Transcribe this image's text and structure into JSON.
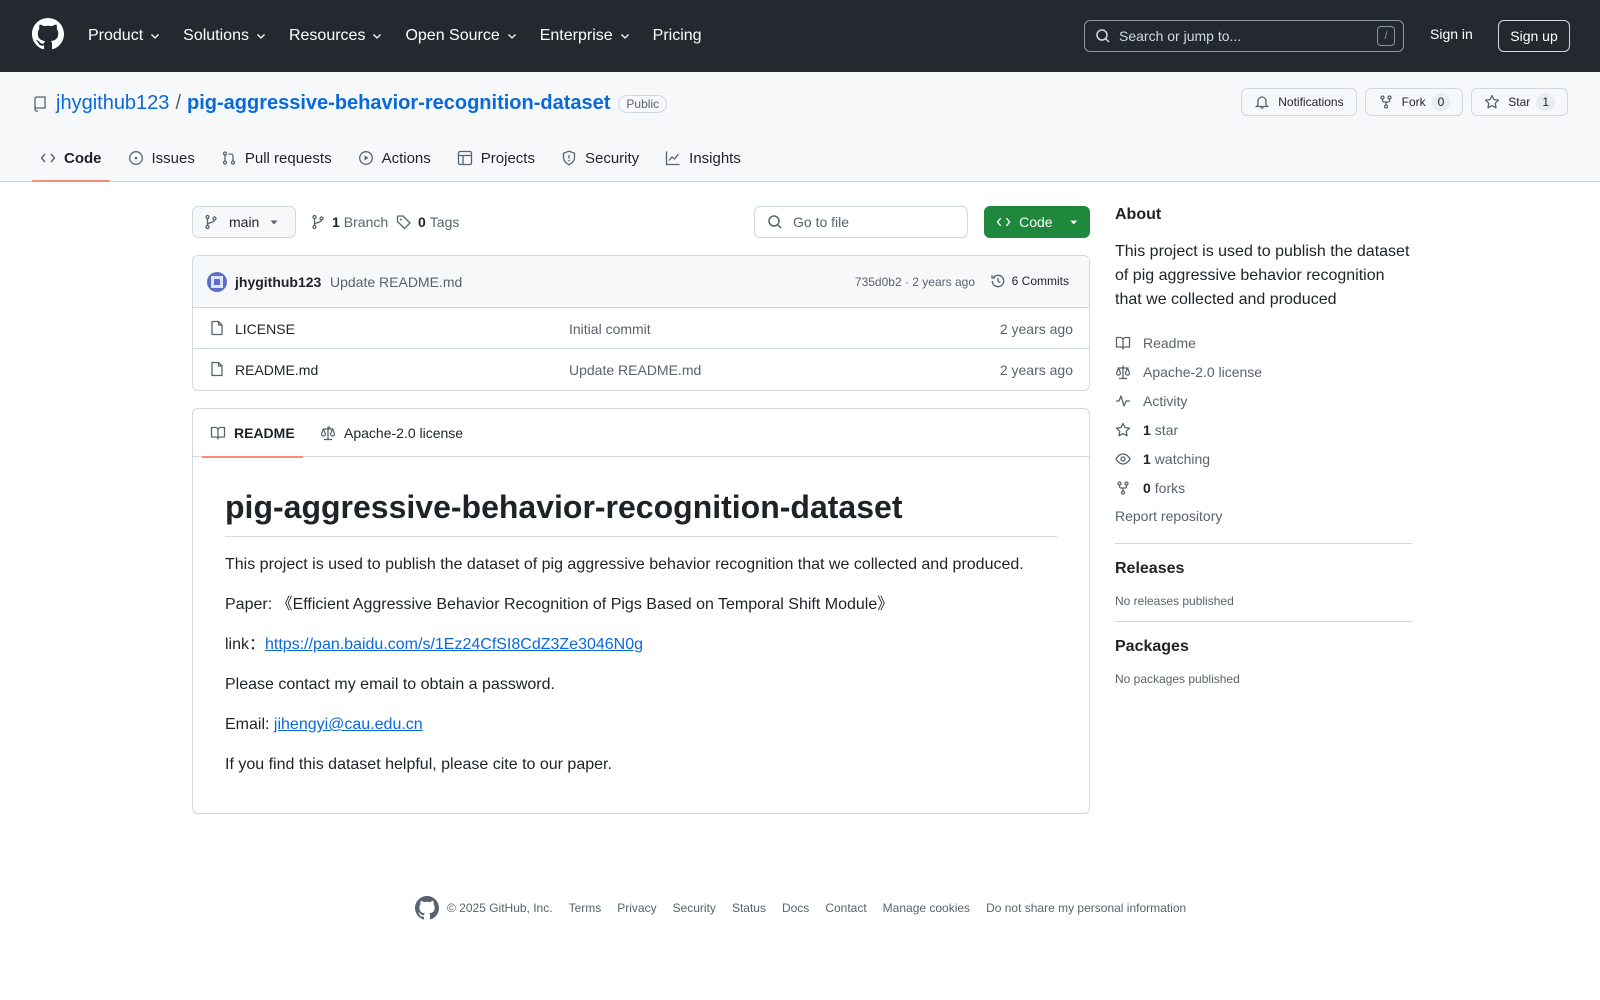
{
  "header": {
    "nav": [
      "Product",
      "Solutions",
      "Resources",
      "Open Source",
      "Enterprise",
      "Pricing"
    ],
    "search_placeholder": "Search or jump to...",
    "search_shortcut": "/",
    "sign_in": "Sign in",
    "sign_up": "Sign up"
  },
  "repo": {
    "owner": "jhygithub123",
    "separator": "/",
    "name": "pig-aggressive-behavior-recognition-dataset",
    "visibility": "Public",
    "actions": {
      "notifications": "Notifications",
      "fork": "Fork",
      "fork_count": "0",
      "star": "Star",
      "star_count": "1"
    },
    "tabs": [
      "Code",
      "Issues",
      "Pull requests",
      "Actions",
      "Projects",
      "Security",
      "Insights"
    ]
  },
  "toolbar": {
    "branch": "main",
    "branch_count": "1",
    "branch_label": "Branch",
    "tag_count": "0",
    "tag_label": "Tags",
    "goto_placeholder": "Go to file",
    "code_button": "Code"
  },
  "commit": {
    "author": "jhygithub123",
    "message": "Update README.md",
    "meta": "735d0b2 · 2 years ago",
    "count": "6 Commits"
  },
  "files": [
    {
      "name": "LICENSE",
      "message": "Initial commit",
      "age": "2 years ago"
    },
    {
      "name": "README.md",
      "message": "Update README.md",
      "age": "2 years ago"
    }
  ],
  "readme": {
    "tab_readme": "README",
    "tab_license": "Apache-2.0 license",
    "title": "pig-aggressive-behavior-recognition-dataset",
    "p1": "This project is used to publish the dataset of pig aggressive behavior recognition that we collected and produced.",
    "p2": "Paper: 《Efficient Aggressive Behavior Recognition of Pigs Based on Temporal Shift Module》",
    "link_label": "link：",
    "link_url": "https://pan.baidu.com/s/1Ez24CfSI8CdZ3Ze3046N0g",
    "p4": "Please contact my email to obtain a password.",
    "email_label": "Email: ",
    "email": "jihengyi@cau.edu.cn",
    "p6": "If you find this dataset helpful, please cite to our paper."
  },
  "sidebar": {
    "about_title": "About",
    "about_text": "This project is used to publish the dataset of pig aggressive behavior recognition that we collected and produced",
    "readme": "Readme",
    "license": "Apache-2.0 license",
    "activity": "Activity",
    "stars_num": "1",
    "stars_label": "star",
    "watching_num": "1",
    "watching_label": "watching",
    "forks_num": "0",
    "forks_label": "forks",
    "report": "Report repository",
    "releases_title": "Releases",
    "releases_text": "No releases published",
    "packages_title": "Packages",
    "packages_text": "No packages published"
  },
  "footer": {
    "copyright": "© 2025 GitHub, Inc.",
    "links": [
      "Terms",
      "Privacy",
      "Security",
      "Status",
      "Docs",
      "Contact",
      "Manage cookies",
      "Do not share my personal information"
    ]
  },
  "colors": {
    "header_bg": "#24292f",
    "link": "#0969da",
    "primary_button": "#1f883d",
    "tab_underline": "#fd8c73"
  }
}
